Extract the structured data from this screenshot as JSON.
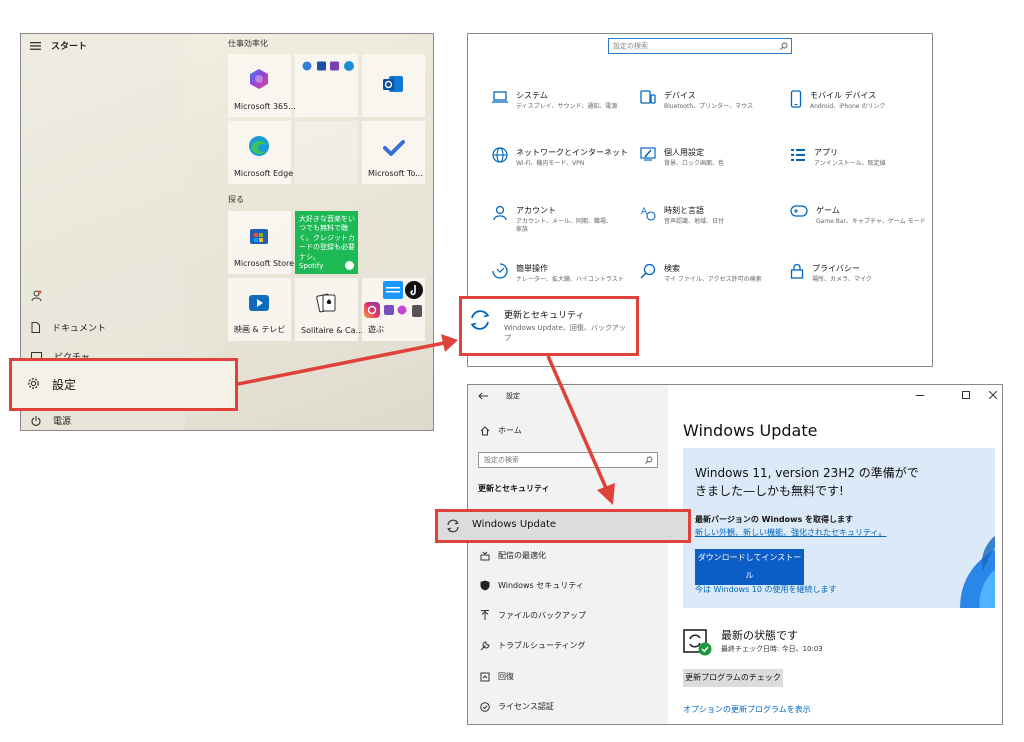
{
  "start_menu": {
    "title": "スタート",
    "group_productivity": "仕事効率化",
    "group_explore": "探る",
    "tiles": {
      "m365": "Microsoft 365...",
      "edge": "Microsoft Edge",
      "todo": "Microsoft To...",
      "store": "Microsoft Store",
      "spotify_text": "大好きな音楽をいつでも無料で聴く。クレジットカードの登録も必要ナシ。",
      "spotify_label": "Spotify",
      "movies": "映画 & テレビ",
      "solitaire": "Solitaire & Ca...",
      "play": "遊ぶ"
    },
    "items": {
      "documents": "ドキュメント",
      "pictures": "ピクチャ",
      "settings": "設定",
      "power": "電源"
    }
  },
  "settings_home": {
    "search_placeholder": "設定の検索",
    "categories": [
      {
        "title": "システム",
        "sub": "ディスプレイ、サウンド、通知、電源"
      },
      {
        "title": "デバイス",
        "sub": "Bluetooth、プリンター、マウス"
      },
      {
        "title": "モバイル デバイス",
        "sub": "Android、iPhone のリンク"
      },
      {
        "title": "ネットワークとインターネット",
        "sub": "Wi-Fi、機内モード、VPN"
      },
      {
        "title": "個人用設定",
        "sub": "背景、ロック画面、色"
      },
      {
        "title": "アプリ",
        "sub": "アンインストール、既定値"
      },
      {
        "title": "アカウント",
        "sub": "アカウント、メール、同期、職場、家族"
      },
      {
        "title": "時刻と言語",
        "sub": "音声認識、地域、日付"
      },
      {
        "title": "ゲーム",
        "sub": "Game Bar、キャプチャ、ゲーム モード"
      },
      {
        "title": "簡単操作",
        "sub": "ナレーター、拡大鏡、ハイコントラスト"
      },
      {
        "title": "検索",
        "sub": "マイ ファイル、アクセス許可の検索"
      },
      {
        "title": "プライバシー",
        "sub": "場所、カメラ、マイク"
      }
    ],
    "update_security": {
      "title": "更新とセキュリティ",
      "sub": "Windows Update、回復、バックアップ"
    }
  },
  "windows_update": {
    "window_title": "設定",
    "home": "ホーム",
    "search_placeholder": "設定の検索",
    "section": "更新とセキュリティ",
    "nav": [
      "Windows Update",
      "配信の最適化",
      "Windows セキュリティ",
      "ファイルのバックアップ",
      "トラブルシューティング",
      "回復",
      "ライセンス認証"
    ],
    "page_title": "Windows Update",
    "banner": {
      "headline": "Windows 11, version 23H2 の準備ができました—しかも無料です!",
      "subhead": "最新バージョンの Windows を取得します",
      "link": "新しい外観、新しい機能、強化されたセキュリティ。",
      "download_button": "ダウンロードしてインストール",
      "stay_link": "今は Windows 10 の使用を継続します"
    },
    "status_title": "最新の状態です",
    "status_sub": "最終チェック日時: 今日、10:03",
    "check_button": "更新プログラムのチェック",
    "optional_link": "オプションの更新プログラムを表示"
  },
  "colors": {
    "accent": "#0c5ec6",
    "highlight": "#e0413a",
    "link": "#0067c0"
  }
}
